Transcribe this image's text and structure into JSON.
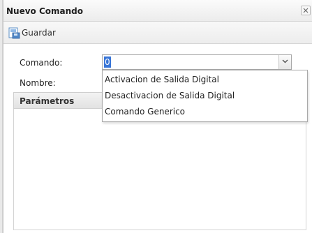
{
  "window": {
    "title": "Nuevo Comando",
    "close_icon": "close-icon"
  },
  "toolbar": {
    "save_label": "Guardar",
    "save_icon": "save-icon"
  },
  "form": {
    "comando_label": "Comando:",
    "comando_value": "0",
    "nombre_label": "Nombre:",
    "params_title": "Parámetros"
  },
  "dropdown": {
    "options": [
      "Activacion de Salida Digital",
      "Desactivacion de Salida Digital",
      "Comando Generico"
    ]
  },
  "colors": {
    "selection": "#3875d7",
    "border": "#a8a8a8"
  }
}
